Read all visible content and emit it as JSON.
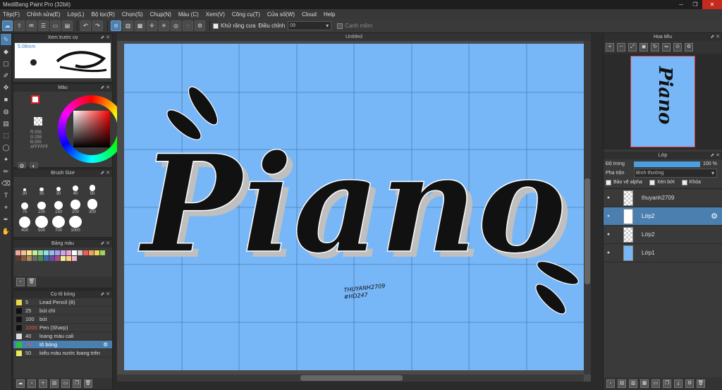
{
  "app": {
    "title": "MediBang Paint Pro (32bit)"
  },
  "menu": [
    "Tệp(F)",
    "Chỉnh sửa(E)",
    "Lớp(L)",
    "Bộ lọc(R)",
    "Chọn(S)",
    "Chụp(N)",
    "Màu (C)",
    "Xem(V)",
    "Công cụ(T)",
    "Cửa số(W)",
    "Cloud",
    "Help"
  ],
  "toolbar": {
    "antialias_label": "Khử răng cưa",
    "correction_label": "Điều chỉnh",
    "correction_value": "09",
    "snap_label": "Cạnh mềm"
  },
  "panels": {
    "brush_preview": {
      "title": "Xem trước cọ",
      "size": "5.08mm"
    },
    "color": {
      "title": "Màu",
      "r": "R:255",
      "g": "G:255",
      "b": "B:255",
      "hex": "#FFFFFF"
    },
    "brush_size": {
      "title": "Brush Size",
      "sizes": [
        "30",
        "35",
        "30",
        "40",
        "50",
        "70",
        "100",
        "150",
        "200",
        "300",
        "400",
        "500",
        "700",
        "1000"
      ]
    },
    "palette": {
      "title": "Bảng màu",
      "colors": [
        "#f4a3a3",
        "#f7c08a",
        "#f7e58a",
        "#c6ef8f",
        "#8fe3a8",
        "#8fe3e0",
        "#8fbfef",
        "#a8a0ef",
        "#d6a0ef",
        "#efa0d6",
        "#ffffff",
        "#cccccc",
        "#ef5a5a",
        "#efa05a",
        "#efd45a",
        "#a0d45a",
        "#5a3a2a",
        "#8a5a3a",
        "#b08a5a",
        "#6a6a6a",
        "#4a8a4a",
        "#3a6aaa",
        "#6a4aaa",
        "#aa4a8a",
        "#efef9a",
        "#ffd080",
        "#f0b0d0"
      ]
    },
    "brushes": {
      "title": "Cọ tô bóng",
      "items": [
        {
          "size": "5",
          "name": "Lead Pencil (8)",
          "color": "#e8d84a"
        },
        {
          "size": "25",
          "name": "bút chì",
          "color": "#111111"
        },
        {
          "size": "100",
          "name": "bút",
          "color": "#111111"
        },
        {
          "size": "1000",
          "name": "Pen (Sharp)",
          "color": "#111111"
        },
        {
          "size": "40",
          "name": "loang màu cali",
          "color": "#dddddd"
        },
        {
          "size": "70",
          "name": "tô bóng",
          "color": "#2fbf3f"
        },
        {
          "size": "50",
          "name": "kiểu màu nước loang trên",
          "color": "#e8e85a"
        }
      ]
    },
    "navigator": {
      "title": "Hoa tiêu"
    },
    "layers": {
      "title": "Lớp",
      "opacity_label": "Độ trong",
      "opacity_value": "100 %",
      "blend_label": "Pha trộn",
      "blend_value": "Bình thường",
      "protect_alpha": "Bảo vệ alpha",
      "clip": "Xén bớt",
      "lock": "Khóa",
      "items": [
        {
          "name": "thuyanh2709"
        },
        {
          "name": "Lớp2"
        },
        {
          "name": "Lớp2"
        },
        {
          "name": "Lớp1"
        }
      ]
    }
  },
  "canvas": {
    "title": "Untitled",
    "bg_color": "#77b7f7",
    "artwork_text": "Piano",
    "signature_line1": "THUYANH2709",
    "signature_line2": "#HD247"
  }
}
